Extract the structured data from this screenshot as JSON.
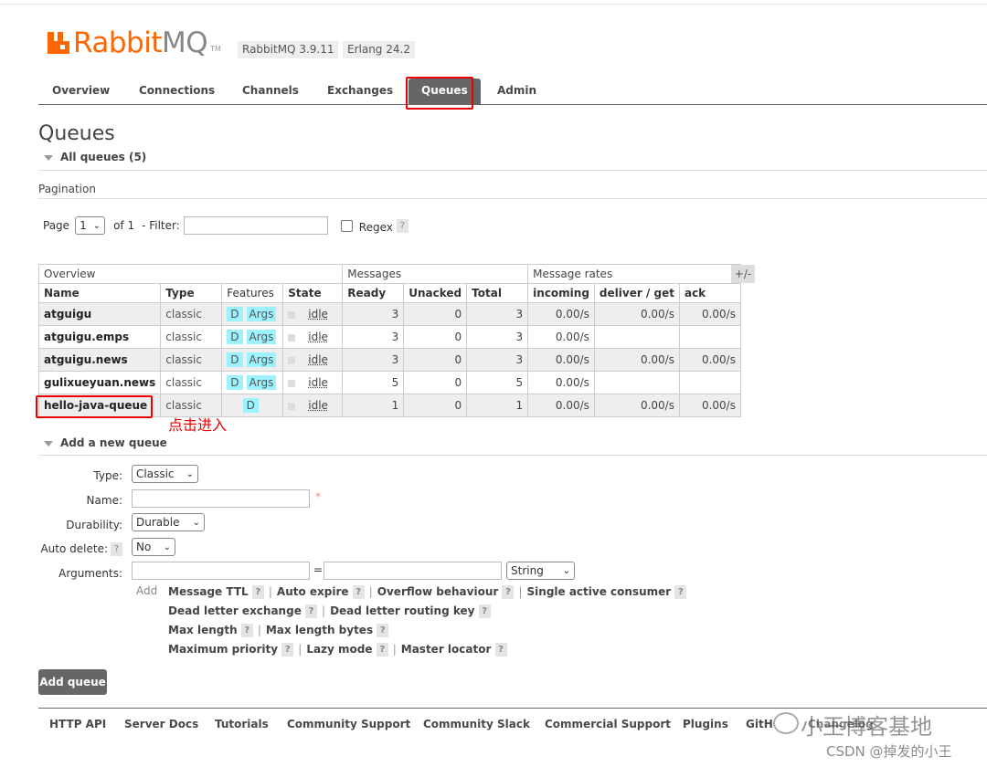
{
  "header": {
    "logo_rabbit": "Rabbit",
    "logo_mq": "MQ",
    "logo_tm": "TM",
    "version_rabbitmq": "RabbitMQ 3.9.11",
    "version_erlang": "Erlang 24.2"
  },
  "nav": {
    "tabs": [
      "Overview",
      "Connections",
      "Channels",
      "Exchanges",
      "Queues",
      "Admin"
    ],
    "active": "Queues"
  },
  "page": {
    "title": "Queues",
    "all_queues": "All queues (5)",
    "pagination_label": "Pagination",
    "page_label": "Page",
    "page_value": "1",
    "of_label": "of 1",
    "filter_label": "- Filter:",
    "filter_value": "",
    "regex_label": "Regex",
    "help": "?"
  },
  "table": {
    "groups": [
      "Overview",
      "Messages",
      "Message rates"
    ],
    "plus_minus": "+/-",
    "columns": [
      "Name",
      "Type",
      "Features",
      "State",
      "Ready",
      "Unacked",
      "Total",
      "incoming",
      "deliver / get",
      "ack"
    ],
    "rows": [
      {
        "name": "atguigu",
        "type": "classic",
        "d": "D",
        "args": "Args",
        "state": "idle",
        "ready": "3",
        "unacked": "0",
        "total": "3",
        "incoming": "0.00/s",
        "deliver": "0.00/s",
        "ack": "0.00/s"
      },
      {
        "name": "atguigu.emps",
        "type": "classic",
        "d": "D",
        "args": "Args",
        "state": "idle",
        "ready": "3",
        "unacked": "0",
        "total": "3",
        "incoming": "0.00/s",
        "deliver": "",
        "ack": ""
      },
      {
        "name": "atguigu.news",
        "type": "classic",
        "d": "D",
        "args": "Args",
        "state": "idle",
        "ready": "3",
        "unacked": "0",
        "total": "3",
        "incoming": "0.00/s",
        "deliver": "0.00/s",
        "ack": "0.00/s"
      },
      {
        "name": "gulixueyuan.news",
        "type": "classic",
        "d": "D",
        "args": "Args",
        "state": "idle",
        "ready": "5",
        "unacked": "0",
        "total": "5",
        "incoming": "0.00/s",
        "deliver": "",
        "ack": ""
      },
      {
        "name": "hello-java-queue",
        "type": "classic",
        "d": "D",
        "args": "",
        "state": "idle",
        "ready": "1",
        "unacked": "0",
        "total": "1",
        "incoming": "0.00/s",
        "deliver": "0.00/s",
        "ack": "0.00/s"
      }
    ],
    "annotation": "点击进入"
  },
  "add_queue": {
    "section": "Add a new queue",
    "type_label": "Type:",
    "type_value": "Classic",
    "name_label": "Name:",
    "name_value": "",
    "required": "*",
    "durability_label": "Durability:",
    "durability_value": "Durable",
    "auto_delete_label": "Auto delete:",
    "auto_delete_value": "No",
    "arguments_label": "Arguments:",
    "equals": "=",
    "arg_type_value": "String",
    "add_word": "Add",
    "arg_links": [
      [
        "Message TTL",
        "Auto expire",
        "Overflow behaviour",
        "Single active consumer"
      ],
      [
        "Dead letter exchange",
        "Dead letter routing key"
      ],
      [
        "Max length",
        "Max length bytes"
      ],
      [
        "Maximum priority",
        "Lazy mode",
        "Master locator"
      ]
    ],
    "button": "Add queue"
  },
  "footer": {
    "links": [
      "HTTP API",
      "Server Docs",
      "Tutorials",
      "Community Support",
      "Community Slack",
      "Commercial Support",
      "Plugins",
      "GitH"
    ],
    "watermark_main": "小王博客基地",
    "watermark_sub": "CSDN @掉发的小王",
    "partial_link": "Changelog"
  },
  "colors": {
    "brand": "#ff6600",
    "tab_active": "#666666",
    "feature_tag": "#9cf2ff",
    "annotation": "#ee0000"
  }
}
